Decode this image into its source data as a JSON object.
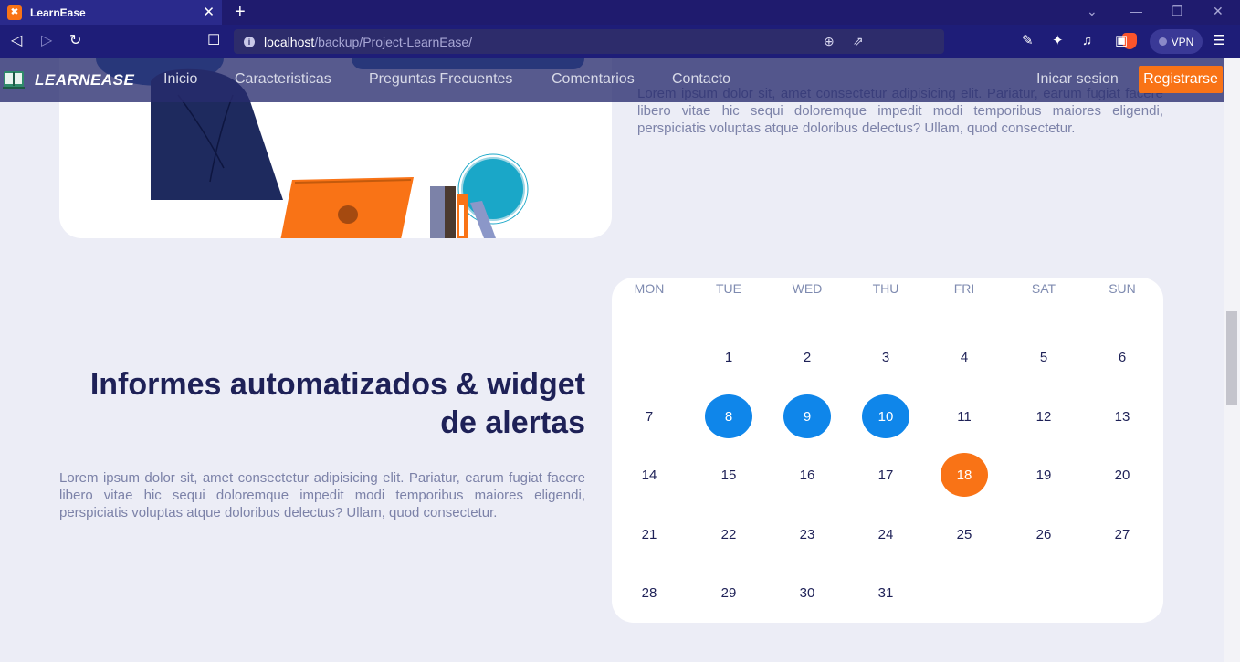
{
  "browser": {
    "tab_title": "LearnEase",
    "url_host": "localhost",
    "url_path": "/backup/Project-LearnEase/",
    "vpn_label": "VPN"
  },
  "site": {
    "logo_text": "LEARNEASE",
    "nav": {
      "home": "Inicio",
      "features": "Caracteristicas",
      "faq": "Preguntas Frecuentes",
      "comments": "Comentarios",
      "contact": "Contacto",
      "login": "Inicar sesion",
      "register": "Registrarse"
    }
  },
  "content": {
    "top_paragraph": "Lorem ipsum dolor sit, amet consectetur adipisicing elit. Pariatur, earum fugiat facere libero vitae hic sequi doloremque impedit modi temporibus maiores eligendi, perspiciatis voluptas atque doloribus delectus? Ullam, quod consectetur.",
    "heading": "Informes automatizados & widget de alertas",
    "paragraph": "Lorem ipsum dolor sit, amet consectetur adipisicing elit. Pariatur, earum fugiat facere libero vitae hic sequi doloremque impedit modi temporibus maiores eligendi, perspiciatis voluptas atque doloribus delectus? Ullam, quod consectetur."
  },
  "calendar": {
    "weekdays": [
      "MON",
      "TUE",
      "WED",
      "THU",
      "FRI",
      "SAT",
      "SUN"
    ],
    "first_weekday_index": 1,
    "days_in_month": 31,
    "selected_days": [
      8,
      9,
      10
    ],
    "highlighted_day": 18,
    "colors": {
      "selected": "#0f86ea",
      "highlighted": "#f97316"
    }
  },
  "colors": {
    "accent": "#f97316",
    "heading": "#1e2157",
    "body_text": "#7c82a8",
    "browser_chrome": "#1e1d78"
  }
}
